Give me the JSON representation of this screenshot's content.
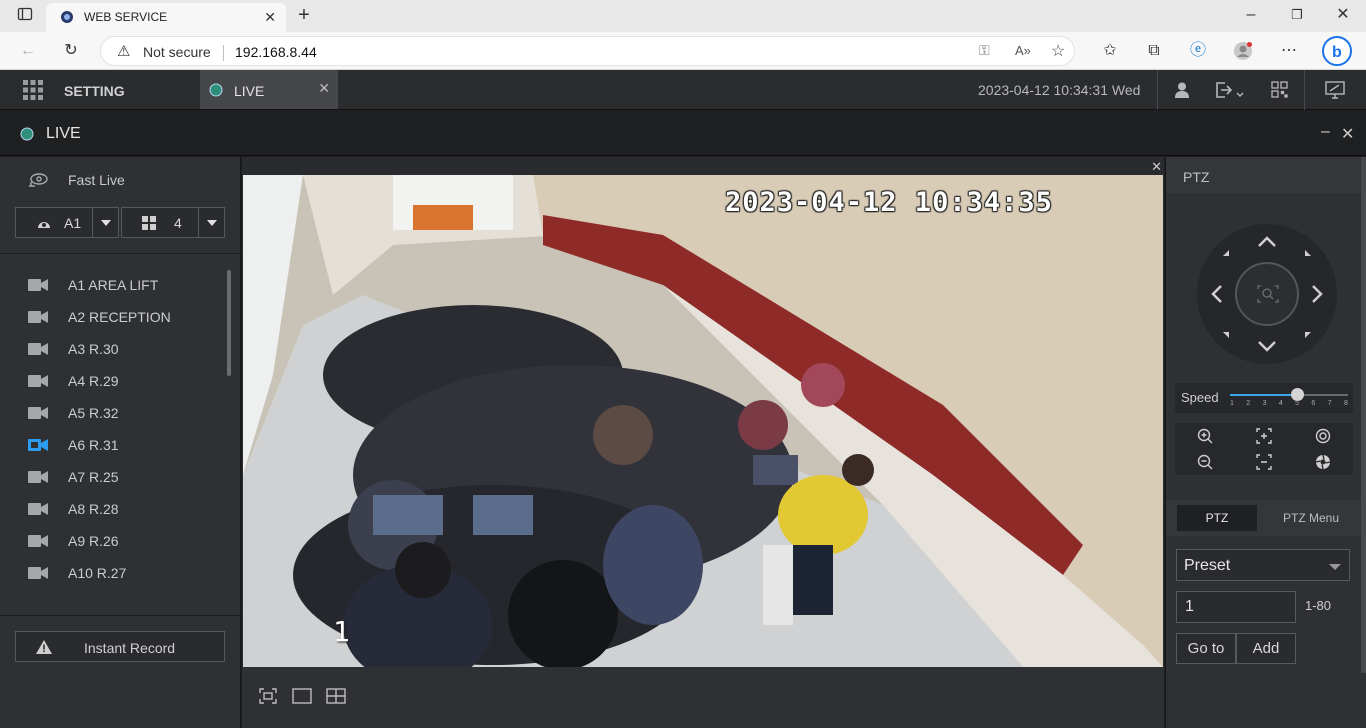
{
  "browser": {
    "tab_title": "WEB SERVICE",
    "security_label": "Not secure",
    "url": "192.168.8.44"
  },
  "app": {
    "setting_label": "SETTING",
    "live_tab_label": "LIVE",
    "datetime": "2023-04-12 10:34:31 Wed",
    "live_header": "LIVE"
  },
  "left_panel": {
    "fast_live": "Fast Live",
    "channel_select": "A1",
    "layout_select": "4",
    "channels": [
      {
        "label": "A1 AREA LIFT",
        "active": false
      },
      {
        "label": "A2 RECEPTION",
        "active": false
      },
      {
        "label": "A3 R.30",
        "active": false
      },
      {
        "label": "A4 R.29",
        "active": false
      },
      {
        "label": "A5 R.32",
        "active": false
      },
      {
        "label": "A6 R.31",
        "active": true
      },
      {
        "label": "A7 R.25",
        "active": false
      },
      {
        "label": "A8 R.28",
        "active": false
      },
      {
        "label": "A9 R.26",
        "active": false
      },
      {
        "label": "A10 R.27",
        "active": false
      }
    ],
    "instant_record": "Instant Record"
  },
  "video": {
    "osd_time": "2023-04-12 10:34:35",
    "osd_channel": "1"
  },
  "ptz": {
    "title": "PTZ",
    "speed_label": "Speed",
    "speed_value": 5,
    "speed_ticks": [
      "1",
      "2",
      "3",
      "4",
      "5",
      "6",
      "7",
      "8"
    ],
    "tab_ptz": "PTZ",
    "tab_ptz_menu": "PTZ Menu",
    "preset_select": "Preset",
    "preset_number": "1",
    "preset_range": "1-80",
    "goto_label": "Go to",
    "add_label": "Add"
  },
  "colors": {
    "accent": "#3aa8e8",
    "active_camera": "#2d9bf0"
  }
}
